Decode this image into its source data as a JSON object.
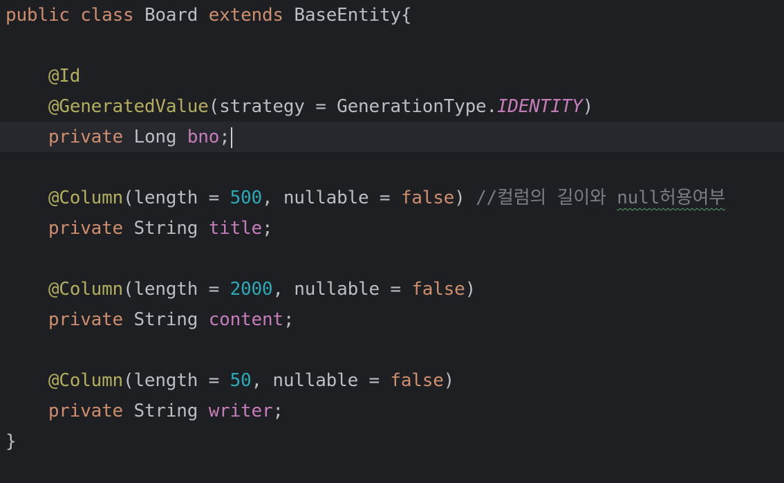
{
  "editor": {
    "colors": {
      "background": "#1e1f22",
      "current_line": "#26282e",
      "keyword": "#cf8e6d",
      "identifier": "#bcbec4",
      "annotation": "#b3ae60",
      "field": "#c77dbb",
      "number": "#2aacb8",
      "comment": "#7a7e85"
    },
    "line1": {
      "kw_public": "public",
      "kw_class": "class",
      "class_name": "Board",
      "kw_extends": "extends",
      "super_class": "BaseEntity",
      "brace_open": "{"
    },
    "line3": {
      "annotation": "@Id"
    },
    "line4": {
      "annotation": "@GeneratedValue",
      "paren_open": "(",
      "param": "strategy",
      "eq": " = ",
      "type": "GenerationType.",
      "constant": "IDENTITY",
      "paren_close": ")"
    },
    "line5": {
      "kw_private": "private",
      "type": "Long",
      "field": "bno",
      "semicolon": ";"
    },
    "line7": {
      "annotation": "@Column",
      "p1_open": "(length = ",
      "length": "500",
      "p1_mid": ", nullable = ",
      "nullable": "false",
      "p1_close": ")",
      "comment_prefix": "//컬럼의 길이와 ",
      "comment_typo": "null",
      "comment_suffix": "허용여부"
    },
    "line8": {
      "kw_private": "private",
      "type": "String",
      "field": "title",
      "semicolon": ";"
    },
    "line10": {
      "annotation": "@Column",
      "p1_open": "(length = ",
      "length": "2000",
      "p1_mid": ", nullable = ",
      "nullable": "false",
      "p1_close": ")"
    },
    "line11": {
      "kw_private": "private",
      "type": "String",
      "field": "content",
      "semicolon": ";"
    },
    "line13": {
      "annotation": "@Column",
      "p1_open": "(length = ",
      "length": "50",
      "p1_mid": ", nullable = ",
      "nullable": "false",
      "p1_close": ")"
    },
    "line14": {
      "kw_private": "private",
      "type": "String",
      "field": "writer",
      "semicolon": ";"
    },
    "line15": {
      "brace_close": "}"
    }
  }
}
